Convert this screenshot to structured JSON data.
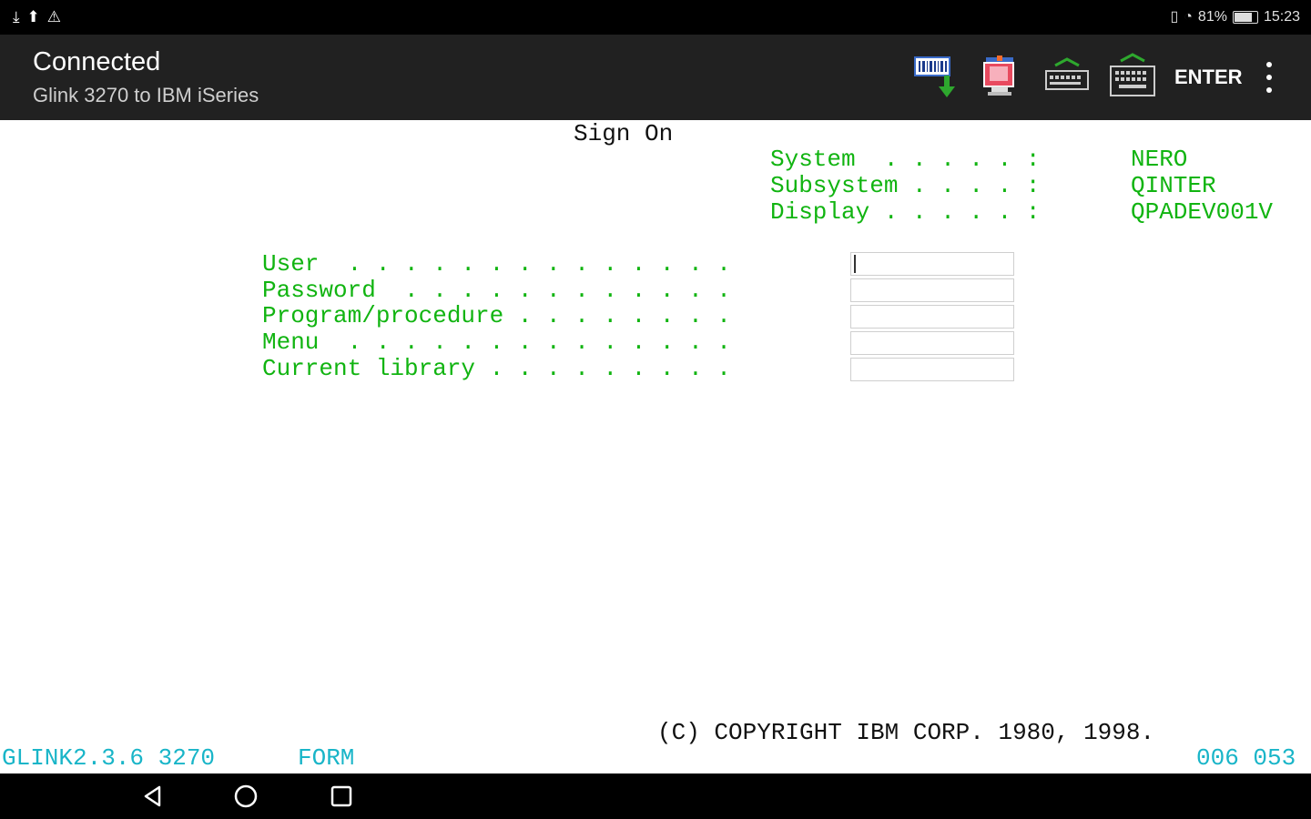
{
  "status_bar": {
    "left_icons": [
      "download-icon",
      "upload-icon",
      "warning-icon"
    ],
    "signal_battery": "81%",
    "time": "15:23"
  },
  "app_bar": {
    "title": "Connected",
    "subtitle": "Glink 3270 to IBM iSeries",
    "actions": [
      "barcode-download-icon",
      "screen-capture-icon",
      "keyboard-collapse-icon",
      "keyboard-expand-icon"
    ],
    "enter_label": "ENTER"
  },
  "terminal": {
    "title": "Sign On",
    "system_label": "System  . . . . . :",
    "system_value": "NERO",
    "subsystem_label": "Subsystem . . . . :",
    "subsystem_value": "QINTER",
    "display_label": "Display . . . . . :",
    "display_value": "QPADEV001V",
    "user_label": "User  . . . . . . . . . . . . . .",
    "password_label": "Password  . . . . . . . . . . . .",
    "program_label": "Program/procedure . . . . . . . .",
    "menu_label": "Menu  . . . . . . . . . . . . . .",
    "library_label": "Current library . . . . . . . . .",
    "copyright": "(C) COPYRIGHT IBM CORP. 1980, 1998.",
    "status_left": "GLINK2.3.6 3270",
    "status_mode": "FORM",
    "cursor_pos": "006 053"
  },
  "colors": {
    "field_label": "#11b411",
    "status_line": "#19b5c8"
  }
}
